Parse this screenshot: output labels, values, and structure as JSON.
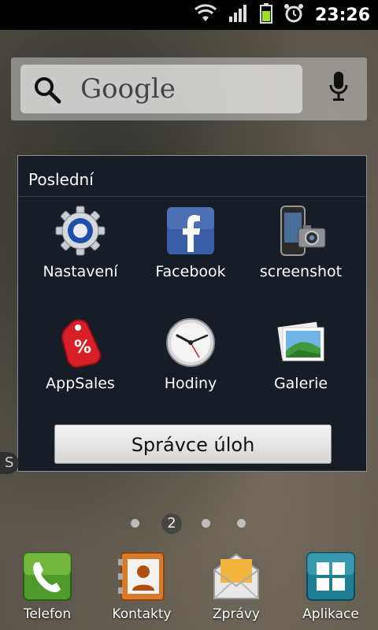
{
  "status_bar": {
    "time": "23:26"
  },
  "search_widget": {
    "placeholder": "Google"
  },
  "recent_dialog": {
    "title": "Poslední",
    "apps": [
      {
        "label": "Nastavení",
        "icon": "settings-gear-icon"
      },
      {
        "label": "Facebook",
        "icon": "facebook-icon"
      },
      {
        "label": "screenshot",
        "icon": "phone-camera-icon"
      },
      {
        "label": "AppSales",
        "icon": "price-tag-icon"
      },
      {
        "label": "Hodiny",
        "icon": "clock-icon"
      },
      {
        "label": "Galerie",
        "icon": "gallery-icon"
      }
    ],
    "task_manager_label": "Správce úloh"
  },
  "hidden_widget": {
    "text": "S"
  },
  "pager": {
    "current_page": "2"
  },
  "dock": {
    "items": [
      {
        "label": "Telefon",
        "icon": "phone-icon"
      },
      {
        "label": "Kontakty",
        "icon": "contacts-icon"
      },
      {
        "label": "Zprávy",
        "icon": "messages-icon"
      },
      {
        "label": "Aplikace",
        "icon": "app-grid-icon"
      }
    ]
  },
  "colors": {
    "dialog_bg": "#171d27",
    "status_bar_bg": "#000000",
    "battery": "#9be01e"
  }
}
